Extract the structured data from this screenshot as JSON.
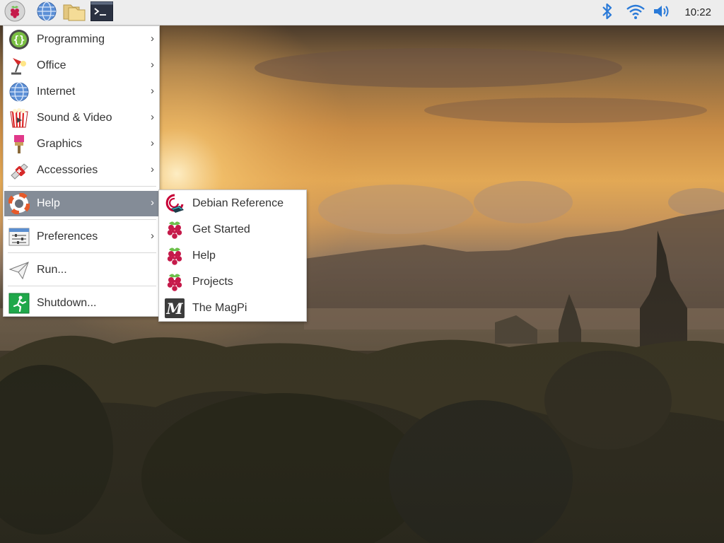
{
  "taskbar": {
    "launchers": [
      {
        "icon": "raspberry-menu-icon"
      },
      {
        "icon": "web-browser-icon"
      },
      {
        "icon": "file-manager-icon"
      },
      {
        "icon": "terminal-icon"
      }
    ],
    "tray": {
      "bluetooth_icon": "bluetooth-icon",
      "wifi_icon": "wifi-icon",
      "volume_icon": "volume-icon",
      "clock": "10:22"
    }
  },
  "main_menu": {
    "items": [
      {
        "label": "Programming",
        "icon": "programming-icon",
        "arrow": "›"
      },
      {
        "label": "Office",
        "icon": "office-icon",
        "arrow": "›"
      },
      {
        "label": "Internet",
        "icon": "internet-icon",
        "arrow": "›"
      },
      {
        "label": "Sound & Video",
        "icon": "sound-video-icon",
        "arrow": "›"
      },
      {
        "label": "Graphics",
        "icon": "graphics-icon",
        "arrow": "›"
      },
      {
        "label": "Accessories",
        "icon": "accessories-icon",
        "arrow": "›"
      },
      {
        "label": "Help",
        "icon": "help-icon",
        "arrow": "›",
        "selected": true
      },
      {
        "label": "Preferences",
        "icon": "preferences-icon",
        "arrow": "›"
      },
      {
        "label": "Run...",
        "icon": "run-icon"
      },
      {
        "label": "Shutdown...",
        "icon": "shutdown-icon"
      }
    ]
  },
  "help_submenu": {
    "items": [
      {
        "label": "Debian Reference",
        "icon": "debian-icon"
      },
      {
        "label": "Get Started",
        "icon": "raspberry-icon"
      },
      {
        "label": "Help",
        "icon": "raspberry-icon"
      },
      {
        "label": "Projects",
        "icon": "raspberry-icon"
      },
      {
        "label": "The MagPi",
        "icon": "magpi-icon"
      }
    ]
  },
  "colors": {
    "menu_selection": "#848c97",
    "raspberry_red": "#c51a4a",
    "raspberry_leaf": "#6cc04a"
  }
}
